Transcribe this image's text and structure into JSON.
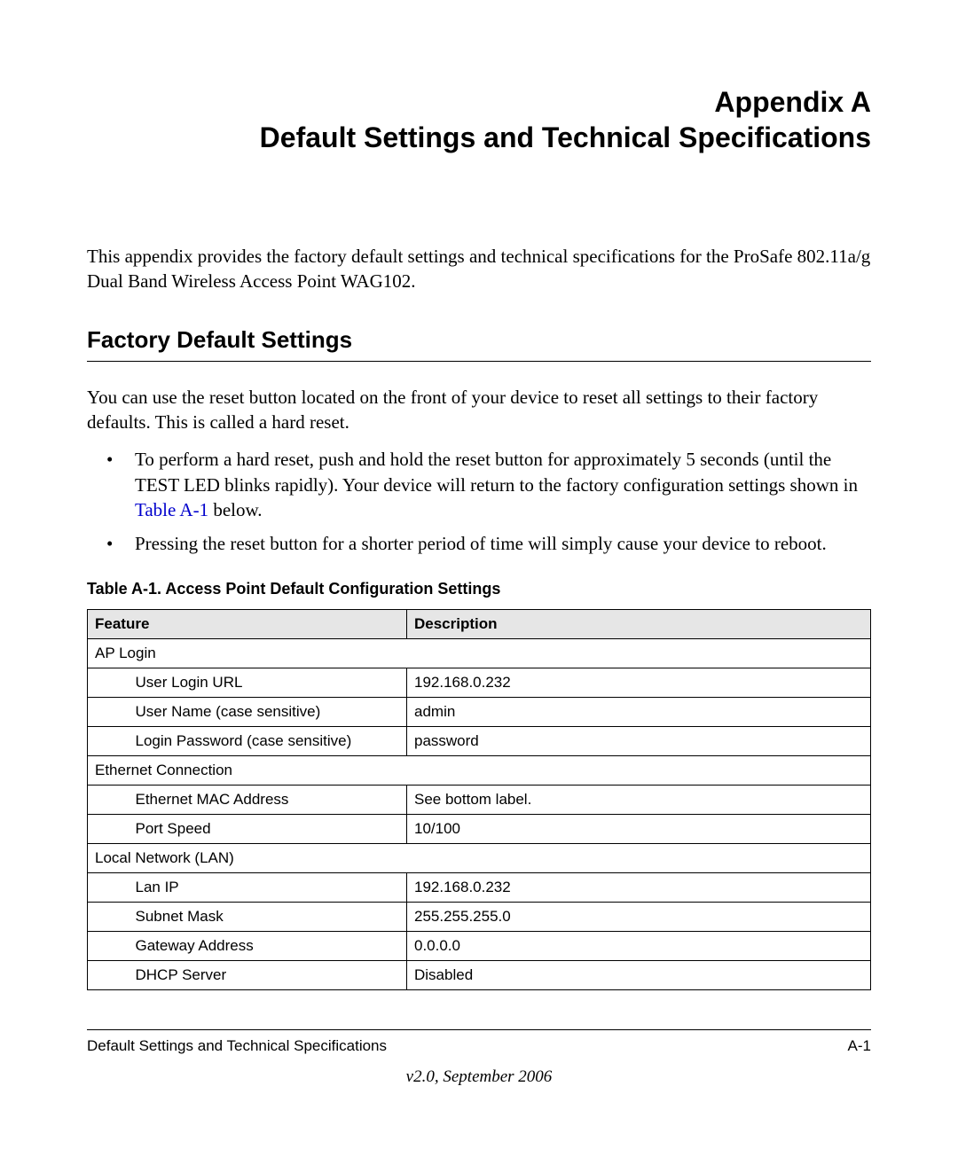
{
  "title": {
    "line1": "Appendix A",
    "line2": "Default Settings and Technical Specifications"
  },
  "intro": "This appendix provides the factory default settings and technical specifications for the ProSafe 802.11a/g Dual Band Wireless Access Point WAG102.",
  "section_heading": "Factory Default Settings",
  "para1": "You can use the reset button located on the front of your device to reset all settings to their factory defaults. This is called a hard reset.",
  "bullets": {
    "b1_pre": "To perform a hard reset, push and hold the reset button for approximately 5 seconds (until the TEST LED blinks rapidly). Your device will return to the factory configuration settings shown in ",
    "b1_link": "Table A-1",
    "b1_post": " below.",
    "b2": "Pressing the reset button for a shorter period of time will simply cause your device to reboot."
  },
  "table": {
    "caption": "Table A-1.   Access Point Default Configuration Settings",
    "headers": {
      "feature": "Feature",
      "description": "Description"
    },
    "groups": [
      {
        "group": "AP Login",
        "rows": [
          {
            "feature": "User Login URL",
            "desc": "192.168.0.232"
          },
          {
            "feature": "User Name (case sensitive)",
            "desc": "admin"
          },
          {
            "feature": "Login Password (case sensitive)",
            "desc": "password"
          }
        ]
      },
      {
        "group": "Ethernet Connection",
        "rows": [
          {
            "feature": "Ethernet MAC Address",
            "desc": "See bottom label."
          },
          {
            "feature": "Port Speed",
            "desc": "10/100"
          }
        ]
      },
      {
        "group": "Local Network (LAN)",
        "rows": [
          {
            "feature": "Lan IP",
            "desc": "192.168.0.232"
          },
          {
            "feature": "Subnet Mask",
            "desc": "255.255.255.0"
          },
          {
            "feature": "Gateway Address",
            "desc": "0.0.0.0"
          },
          {
            "feature": "DHCP Server",
            "desc": "Disabled"
          }
        ]
      }
    ]
  },
  "footer": {
    "left": "Default Settings and Technical Specifications",
    "right": "A-1",
    "version": "v2.0, September 2006"
  }
}
